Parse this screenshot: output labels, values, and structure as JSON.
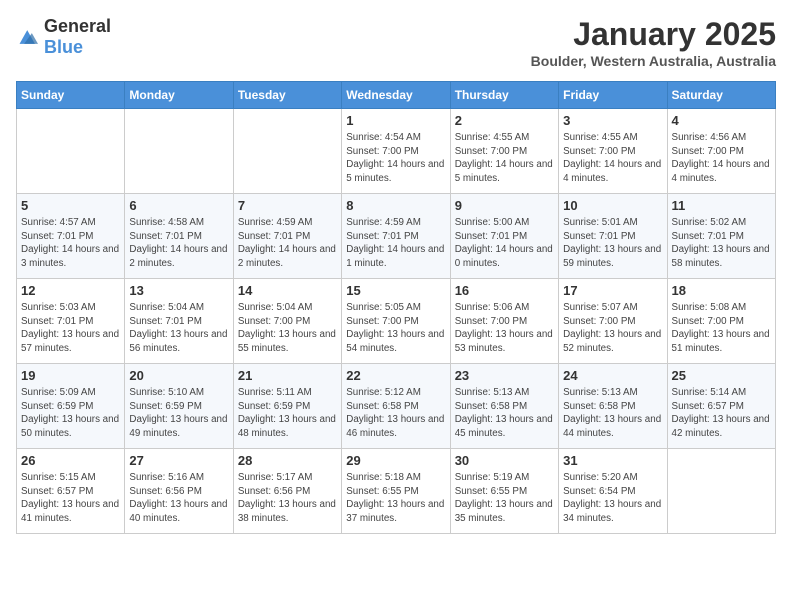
{
  "header": {
    "logo_general": "General",
    "logo_blue": "Blue",
    "month_title": "January 2025",
    "location": "Boulder, Western Australia, Australia"
  },
  "weekdays": [
    "Sunday",
    "Monday",
    "Tuesday",
    "Wednesday",
    "Thursday",
    "Friday",
    "Saturday"
  ],
  "weeks": [
    [
      {
        "day": "",
        "sunrise": "",
        "sunset": "",
        "daylight": ""
      },
      {
        "day": "",
        "sunrise": "",
        "sunset": "",
        "daylight": ""
      },
      {
        "day": "",
        "sunrise": "",
        "sunset": "",
        "daylight": ""
      },
      {
        "day": "1",
        "sunrise": "Sunrise: 4:54 AM",
        "sunset": "Sunset: 7:00 PM",
        "daylight": "Daylight: 14 hours and 5 minutes."
      },
      {
        "day": "2",
        "sunrise": "Sunrise: 4:55 AM",
        "sunset": "Sunset: 7:00 PM",
        "daylight": "Daylight: 14 hours and 5 minutes."
      },
      {
        "day": "3",
        "sunrise": "Sunrise: 4:55 AM",
        "sunset": "Sunset: 7:00 PM",
        "daylight": "Daylight: 14 hours and 4 minutes."
      },
      {
        "day": "4",
        "sunrise": "Sunrise: 4:56 AM",
        "sunset": "Sunset: 7:00 PM",
        "daylight": "Daylight: 14 hours and 4 minutes."
      }
    ],
    [
      {
        "day": "5",
        "sunrise": "Sunrise: 4:57 AM",
        "sunset": "Sunset: 7:01 PM",
        "daylight": "Daylight: 14 hours and 3 minutes."
      },
      {
        "day": "6",
        "sunrise": "Sunrise: 4:58 AM",
        "sunset": "Sunset: 7:01 PM",
        "daylight": "Daylight: 14 hours and 2 minutes."
      },
      {
        "day": "7",
        "sunrise": "Sunrise: 4:59 AM",
        "sunset": "Sunset: 7:01 PM",
        "daylight": "Daylight: 14 hours and 2 minutes."
      },
      {
        "day": "8",
        "sunrise": "Sunrise: 4:59 AM",
        "sunset": "Sunset: 7:01 PM",
        "daylight": "Daylight: 14 hours and 1 minute."
      },
      {
        "day": "9",
        "sunrise": "Sunrise: 5:00 AM",
        "sunset": "Sunset: 7:01 PM",
        "daylight": "Daylight: 14 hours and 0 minutes."
      },
      {
        "day": "10",
        "sunrise": "Sunrise: 5:01 AM",
        "sunset": "Sunset: 7:01 PM",
        "daylight": "Daylight: 13 hours and 59 minutes."
      },
      {
        "day": "11",
        "sunrise": "Sunrise: 5:02 AM",
        "sunset": "Sunset: 7:01 PM",
        "daylight": "Daylight: 13 hours and 58 minutes."
      }
    ],
    [
      {
        "day": "12",
        "sunrise": "Sunrise: 5:03 AM",
        "sunset": "Sunset: 7:01 PM",
        "daylight": "Daylight: 13 hours and 57 minutes."
      },
      {
        "day": "13",
        "sunrise": "Sunrise: 5:04 AM",
        "sunset": "Sunset: 7:01 PM",
        "daylight": "Daylight: 13 hours and 56 minutes."
      },
      {
        "day": "14",
        "sunrise": "Sunrise: 5:04 AM",
        "sunset": "Sunset: 7:00 PM",
        "daylight": "Daylight: 13 hours and 55 minutes."
      },
      {
        "day": "15",
        "sunrise": "Sunrise: 5:05 AM",
        "sunset": "Sunset: 7:00 PM",
        "daylight": "Daylight: 13 hours and 54 minutes."
      },
      {
        "day": "16",
        "sunrise": "Sunrise: 5:06 AM",
        "sunset": "Sunset: 7:00 PM",
        "daylight": "Daylight: 13 hours and 53 minutes."
      },
      {
        "day": "17",
        "sunrise": "Sunrise: 5:07 AM",
        "sunset": "Sunset: 7:00 PM",
        "daylight": "Daylight: 13 hours and 52 minutes."
      },
      {
        "day": "18",
        "sunrise": "Sunrise: 5:08 AM",
        "sunset": "Sunset: 7:00 PM",
        "daylight": "Daylight: 13 hours and 51 minutes."
      }
    ],
    [
      {
        "day": "19",
        "sunrise": "Sunrise: 5:09 AM",
        "sunset": "Sunset: 6:59 PM",
        "daylight": "Daylight: 13 hours and 50 minutes."
      },
      {
        "day": "20",
        "sunrise": "Sunrise: 5:10 AM",
        "sunset": "Sunset: 6:59 PM",
        "daylight": "Daylight: 13 hours and 49 minutes."
      },
      {
        "day": "21",
        "sunrise": "Sunrise: 5:11 AM",
        "sunset": "Sunset: 6:59 PM",
        "daylight": "Daylight: 13 hours and 48 minutes."
      },
      {
        "day": "22",
        "sunrise": "Sunrise: 5:12 AM",
        "sunset": "Sunset: 6:58 PM",
        "daylight": "Daylight: 13 hours and 46 minutes."
      },
      {
        "day": "23",
        "sunrise": "Sunrise: 5:13 AM",
        "sunset": "Sunset: 6:58 PM",
        "daylight": "Daylight: 13 hours and 45 minutes."
      },
      {
        "day": "24",
        "sunrise": "Sunrise: 5:13 AM",
        "sunset": "Sunset: 6:58 PM",
        "daylight": "Daylight: 13 hours and 44 minutes."
      },
      {
        "day": "25",
        "sunrise": "Sunrise: 5:14 AM",
        "sunset": "Sunset: 6:57 PM",
        "daylight": "Daylight: 13 hours and 42 minutes."
      }
    ],
    [
      {
        "day": "26",
        "sunrise": "Sunrise: 5:15 AM",
        "sunset": "Sunset: 6:57 PM",
        "daylight": "Daylight: 13 hours and 41 minutes."
      },
      {
        "day": "27",
        "sunrise": "Sunrise: 5:16 AM",
        "sunset": "Sunset: 6:56 PM",
        "daylight": "Daylight: 13 hours and 40 minutes."
      },
      {
        "day": "28",
        "sunrise": "Sunrise: 5:17 AM",
        "sunset": "Sunset: 6:56 PM",
        "daylight": "Daylight: 13 hours and 38 minutes."
      },
      {
        "day": "29",
        "sunrise": "Sunrise: 5:18 AM",
        "sunset": "Sunset: 6:55 PM",
        "daylight": "Daylight: 13 hours and 37 minutes."
      },
      {
        "day": "30",
        "sunrise": "Sunrise: 5:19 AM",
        "sunset": "Sunset: 6:55 PM",
        "daylight": "Daylight: 13 hours and 35 minutes."
      },
      {
        "day": "31",
        "sunrise": "Sunrise: 5:20 AM",
        "sunset": "Sunset: 6:54 PM",
        "daylight": "Daylight: 13 hours and 34 minutes."
      },
      {
        "day": "",
        "sunrise": "",
        "sunset": "",
        "daylight": ""
      }
    ]
  ]
}
